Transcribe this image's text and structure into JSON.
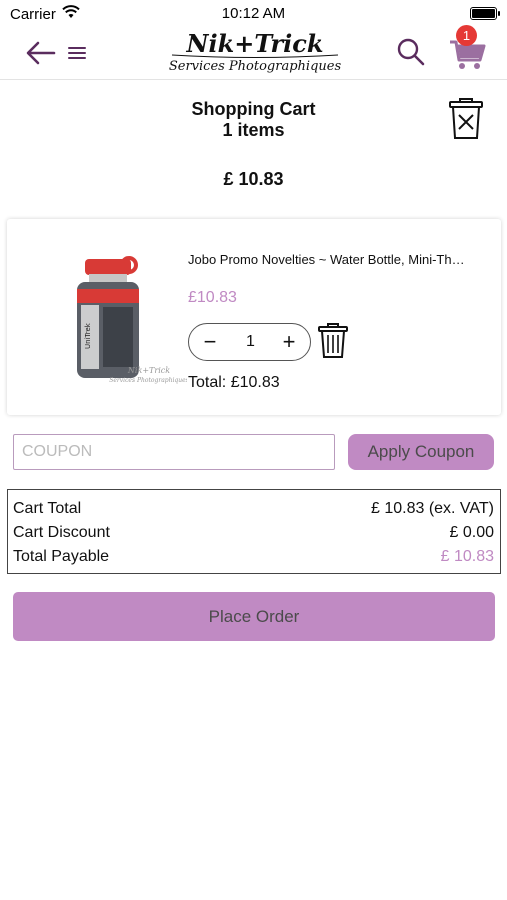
{
  "status_bar": {
    "carrier": "Carrier",
    "time": "10:12 AM"
  },
  "nav": {
    "logo_name": "Nik+Trick",
    "logo_tagline": "Services Photographiques",
    "cart_badge_count": "1",
    "icons": [
      "back-arrow-icon",
      "hamburger-menu-icon",
      "search-icon",
      "cart-icon"
    ]
  },
  "cart": {
    "title": "Shopping Cart",
    "item_count": "1 items",
    "header_total": "£ 10.83"
  },
  "items": [
    {
      "name": "Jobo Promo Novelties ~ Water Bottle, Mini-Th…",
      "price": "£10.83",
      "quantity": "1",
      "minus_label": "−",
      "plus_label": "+",
      "line_total": "Total: £10.83"
    }
  ],
  "coupon": {
    "placeholder": "COUPON",
    "value": "",
    "button_label": "Apply Coupon"
  },
  "summary": {
    "rows": [
      {
        "label": "Cart Total",
        "value": "£ 10.83 (ex. VAT)"
      },
      {
        "label": "Cart Discount",
        "value": "£ 0.00"
      },
      {
        "label": "Total Payable",
        "value": "£ 10.83"
      }
    ]
  },
  "place_order_label": "Place Order",
  "colors": {
    "accent": "#c08ac3",
    "nav_icon": "#5a2c5e",
    "badge": "#e53935"
  }
}
